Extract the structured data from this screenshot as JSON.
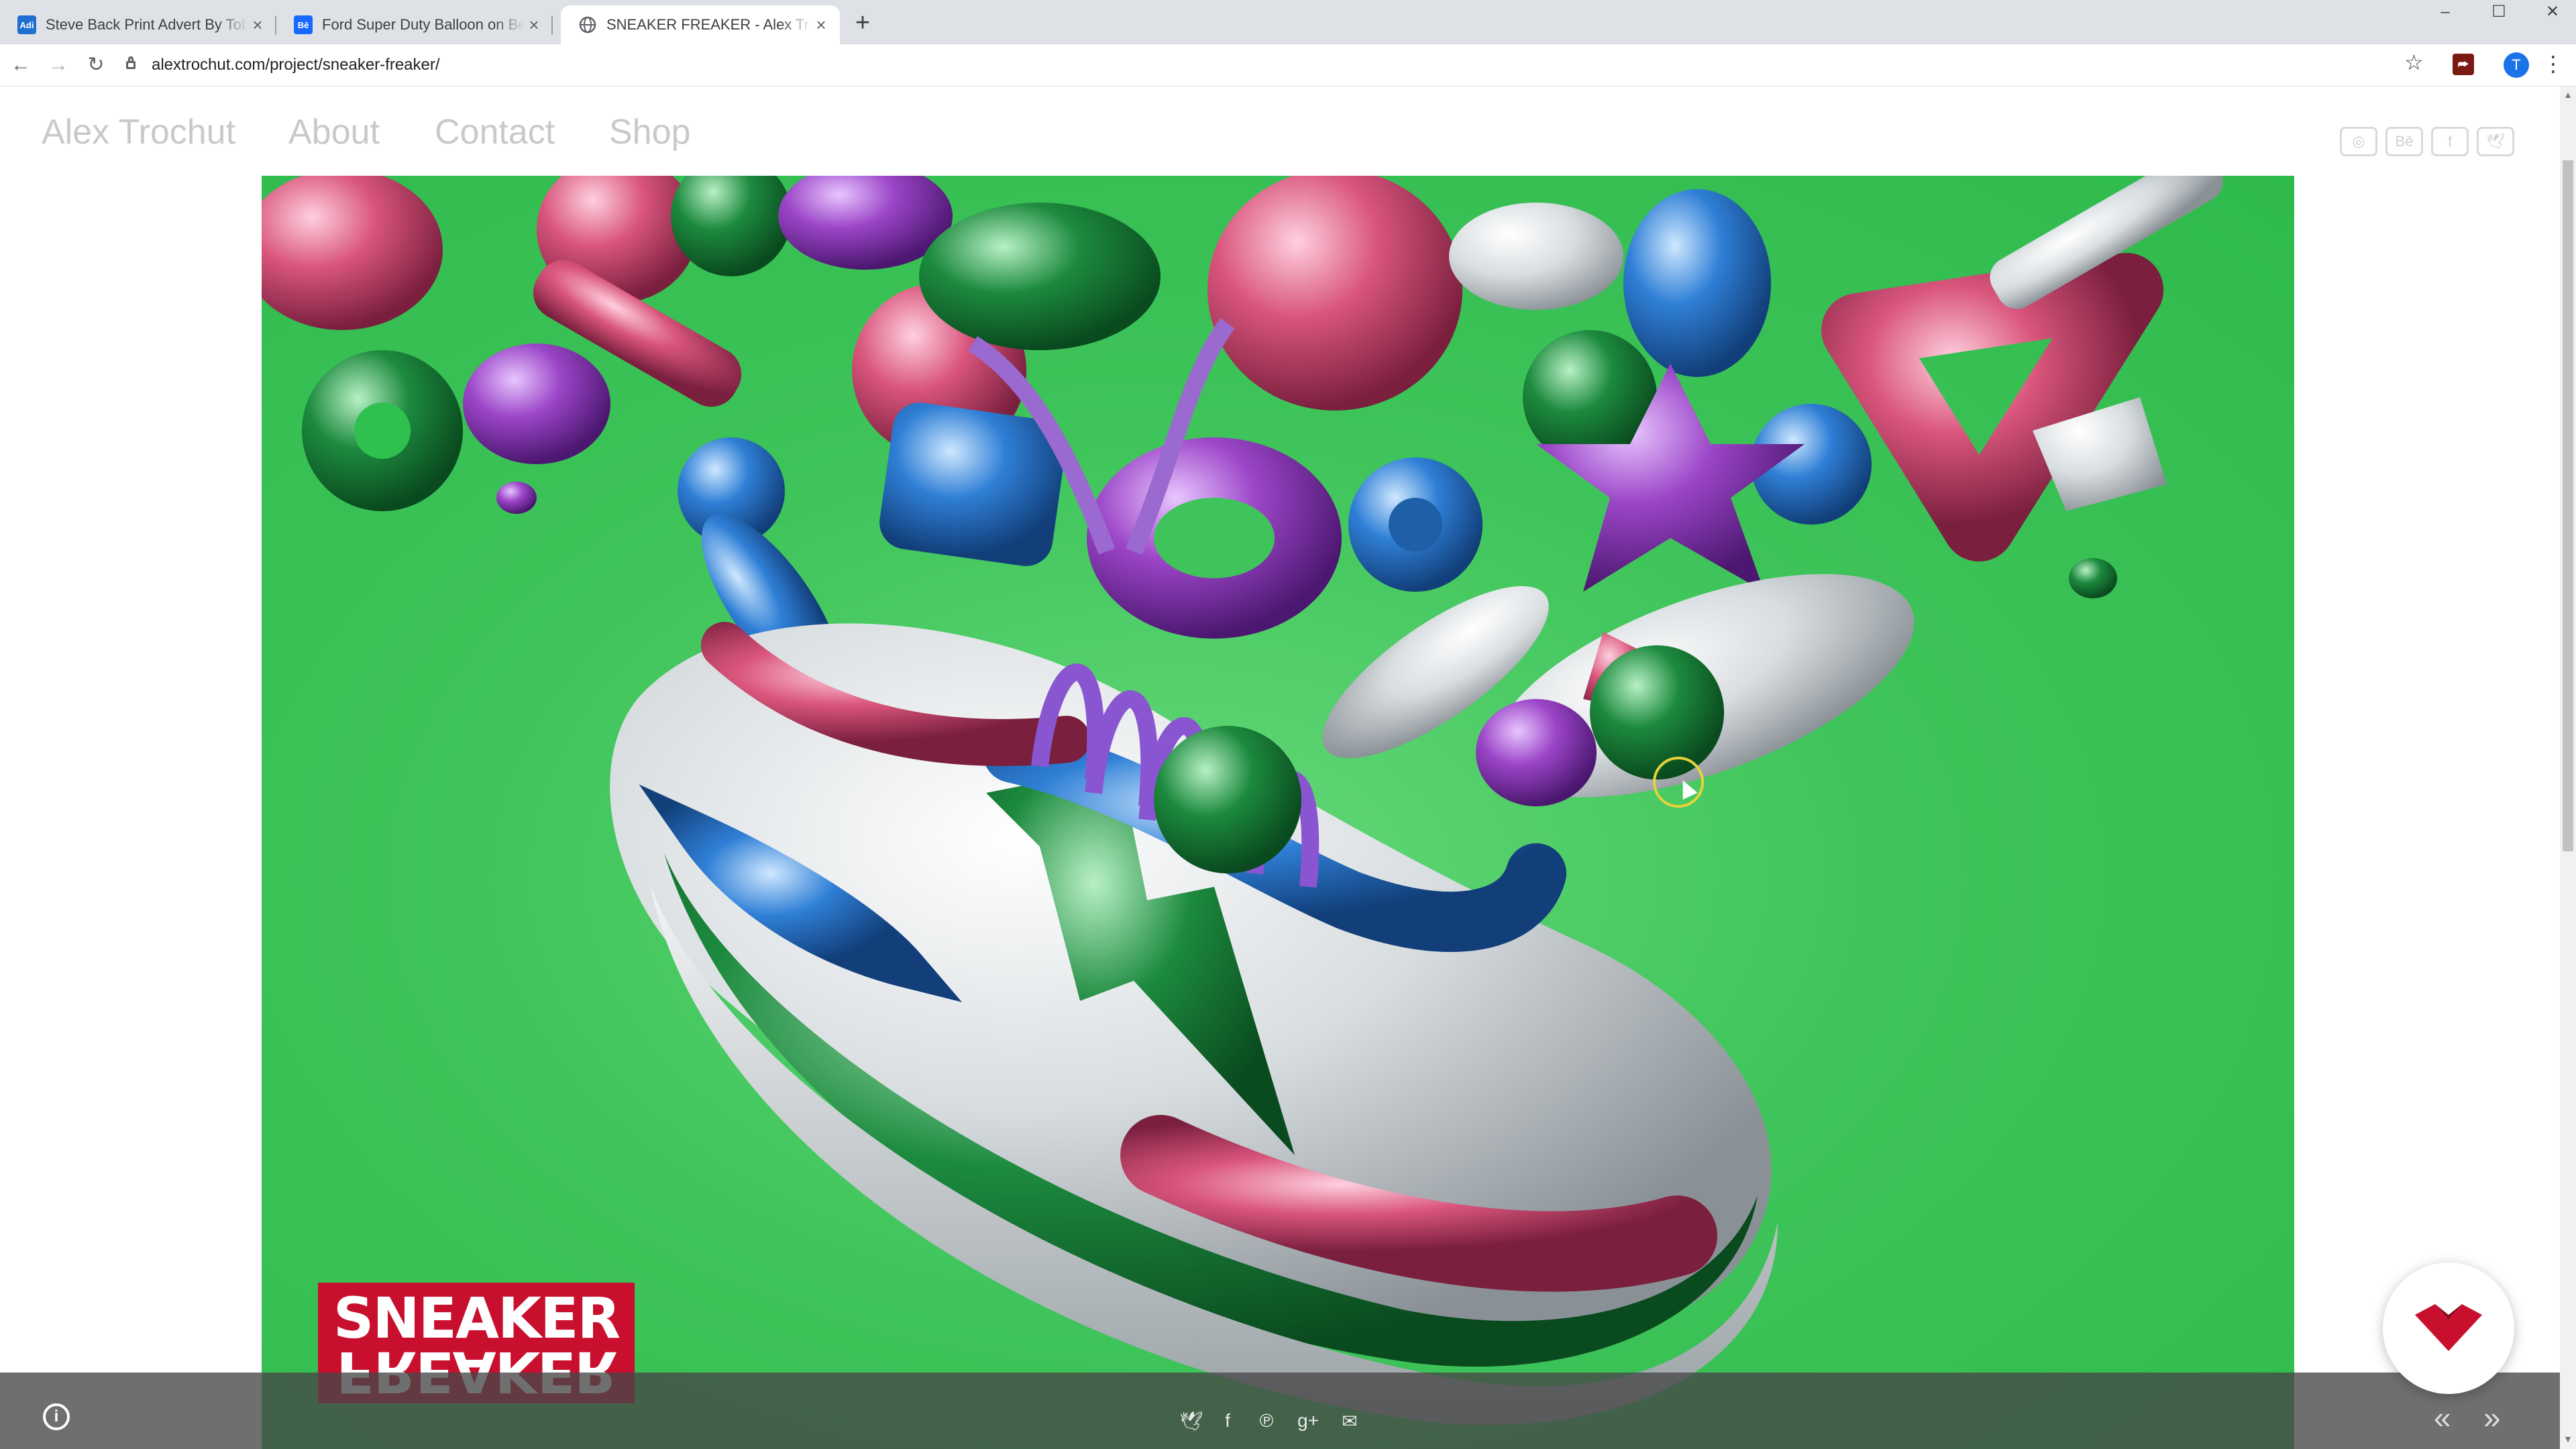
{
  "browser": {
    "tabs": [
      {
        "title": "Steve Back Print Advert By Toby",
        "favicon": "Adi",
        "favicon_color": "#1f6fd1",
        "active": false
      },
      {
        "title": "Ford Super Duty Balloon on Beh",
        "favicon": "Bē",
        "favicon_color": "#1769ff",
        "active": false
      },
      {
        "title": "SNEAKER FREAKER - Alex Trochut",
        "favicon": "globe-icon",
        "favicon_color": "#5f6368",
        "active": true
      }
    ],
    "url": "alextrochut.com/project/sneaker-freaker/",
    "profile_initial": "T"
  },
  "site": {
    "brand": "Alex Trochut",
    "nav": [
      "About",
      "Contact",
      "Shop"
    ],
    "social_icons": [
      "instagram-icon",
      "behance-icon",
      "facebook-icon",
      "twitter-icon"
    ]
  },
  "artwork": {
    "logo_top": "SNEAKER",
    "logo_bottom": "FREAKER",
    "background_color": "#3ec45a"
  },
  "share_icons": [
    "twitter-icon",
    "facebook-icon",
    "pinterest-icon",
    "google-plus-icon",
    "email-icon"
  ],
  "colors": {
    "accent_red": "#c8102e",
    "balloon_pink": "#d9557c",
    "balloon_purple": "#9b45c7",
    "balloon_blue": "#2f7fd6",
    "balloon_green": "#1c8a3e",
    "balloon_silver": "#d8dde0"
  }
}
